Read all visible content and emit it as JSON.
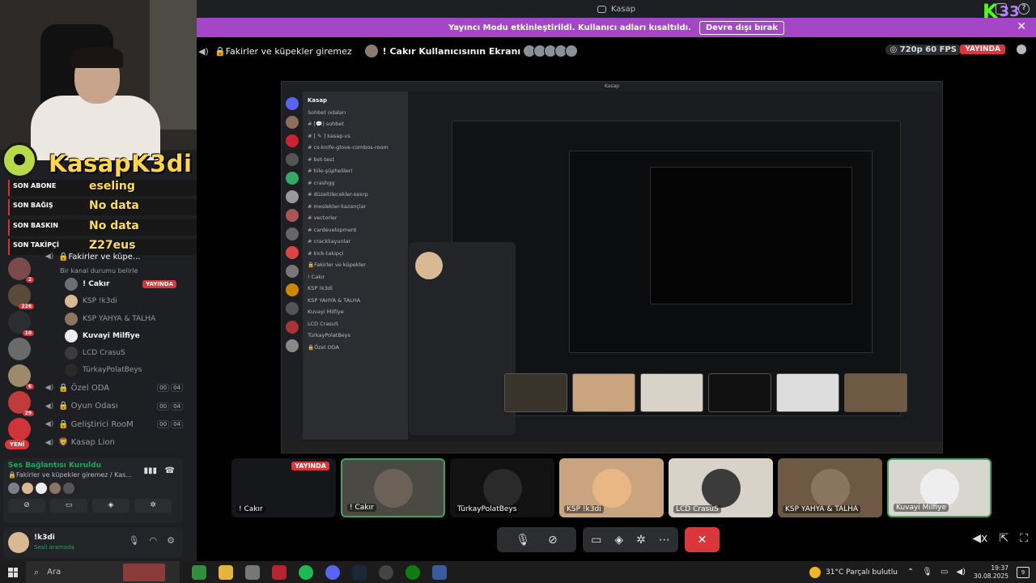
{
  "window": {
    "title": "Kasap"
  },
  "banner": {
    "text": "Yayıncı Modu etkinleştirildi. Kullanıcı adları kısaltıldı.",
    "button": "Devre dışı bırak",
    "close": "✕"
  },
  "stage": {
    "channel": "🔒Fakirler ve küpekler giremez",
    "screen_title": "! Cakır Kullanıcısının Ekranı",
    "quality": "◎ 720p 60 FPS",
    "live_badge": "YAYINDA"
  },
  "overlay": {
    "kick_badge_number": "33",
    "streamer_name": "KasapK3di",
    "stats": [
      {
        "key": "SON ABONE",
        "value": "eseling"
      },
      {
        "key": "SON BAĞIŞ",
        "value": "No data"
      },
      {
        "key": "SON BASKIN",
        "value": "No data"
      },
      {
        "key": "SON TAKİPÇİ",
        "value": "Z27eus"
      }
    ]
  },
  "server_badges": [
    "2",
    "226",
    "10",
    "6",
    "29"
  ],
  "new_badge": "YENİ",
  "channels": {
    "active_voice": "🔒Fakirler ve küpe...",
    "active_voice_status": "Bir kanal durumu belirle",
    "members": [
      {
        "name": "! Cakır",
        "live": "YAYINDA",
        "bright": true
      },
      {
        "name": "KSP !k3di",
        "bright": false
      },
      {
        "name": "KSP YAHYA & TALHA",
        "bright": false
      },
      {
        "name": "Kuvayi Milfiye",
        "bright": true
      },
      {
        "name": "LCD CrasuS",
        "bright": false
      },
      {
        "name": "TürkayPolatBeys",
        "bright": false
      }
    ],
    "other": [
      {
        "name": "Özel ODA",
        "c1": "00",
        "c2": "04"
      },
      {
        "name": "Oyun Odası",
        "c1": "00",
        "c2": "04"
      },
      {
        "name": "Geliştirici RooM",
        "c1": "00",
        "c2": "04"
      },
      {
        "name": "Kasap Lion",
        "c1": "",
        "c2": ""
      }
    ]
  },
  "voice_panel": {
    "title": "Ses Bağlantısı Kuruldu",
    "subtitle": "🔒Fakirler ve küpekler giremez / Kas..."
  },
  "user_panel": {
    "name": "!k3di",
    "status": "Sesli aramada"
  },
  "tiles": [
    {
      "label": "! Cakır",
      "live": "YAYINDA"
    },
    {
      "label": "! Cakır"
    },
    {
      "label": "TürkayPolatBeys"
    },
    {
      "label": "KSP !k3di"
    },
    {
      "label": "LCD CrasuS"
    },
    {
      "label": "KSP YAHYA & TALHA"
    },
    {
      "label": "Kuvayi Milfiye"
    }
  ],
  "screen_caption": "! Cakır",
  "taskbar": {
    "search_placeholder": "Ara",
    "weather": "31°C  Parçalı bulutlu",
    "time": "19:37",
    "date": "30.08.2025",
    "notifications": "9"
  },
  "accent": {
    "brand": "#5865f2",
    "live": "#da373c",
    "streamer_mode": "#a347c6",
    "connected": "#23a55a",
    "overlay_name": "#ffd64a"
  }
}
